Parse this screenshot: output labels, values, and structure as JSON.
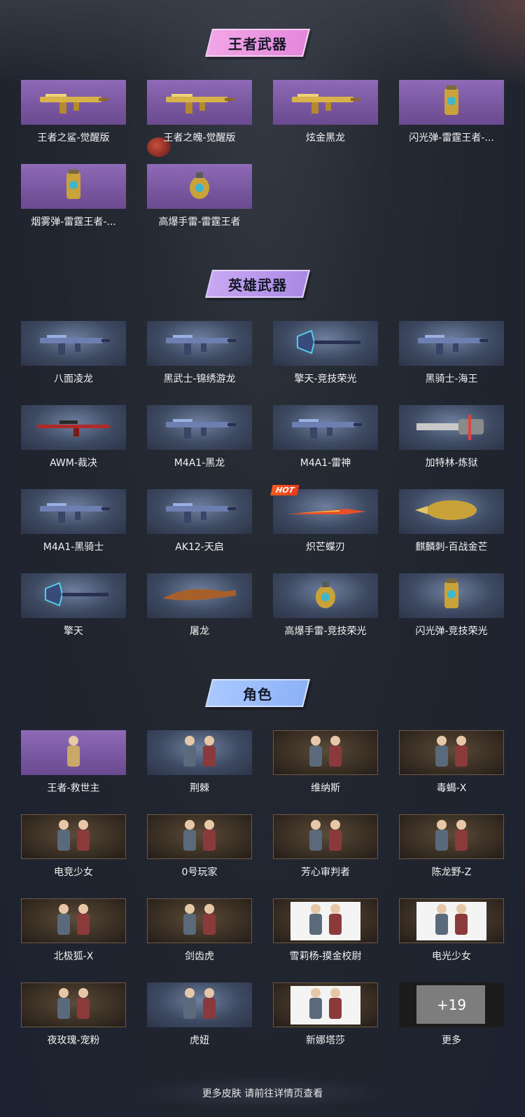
{
  "sections": {
    "king": {
      "title": "王者武器",
      "items": [
        {
          "name": "王者之鲨-觉醒版",
          "icon": "gold-rifle-icon"
        },
        {
          "name": "王者之魄-觉醒版",
          "icon": "gold-rifle-icon"
        },
        {
          "name": "炫金黑龙",
          "icon": "gold-rifle-icon"
        },
        {
          "name": "闪光弹-雷霆王者-...",
          "icon": "flash-grenade-icon"
        },
        {
          "name": "烟雾弹-雷霆王者-...",
          "icon": "smoke-grenade-icon"
        },
        {
          "name": "高爆手雷-雷霆王者",
          "icon": "grenade-icon"
        }
      ]
    },
    "hero": {
      "title": "英雄武器",
      "items": [
        {
          "name": "八面凌龙",
          "icon": "rifle-icon"
        },
        {
          "name": "黑武士-锦绣游龙",
          "icon": "rifle-icon"
        },
        {
          "name": "擎天-竞技荣光",
          "icon": "shovel-icon"
        },
        {
          "name": "黑骑士-海王",
          "icon": "rifle-icon"
        },
        {
          "name": "AWM-裁决",
          "icon": "sniper-icon"
        },
        {
          "name": "M4A1-黑龙",
          "icon": "rifle-icon"
        },
        {
          "name": "M4A1-雷神",
          "icon": "rifle-icon"
        },
        {
          "name": "加特林-炼狱",
          "icon": "gatling-icon"
        },
        {
          "name": "M4A1-黑骑士",
          "icon": "rifle-icon"
        },
        {
          "name": "AK12-天启",
          "icon": "rifle-icon"
        },
        {
          "name": "炽芒蝶刃",
          "icon": "knife-icon",
          "badge": "HOT"
        },
        {
          "name": "麒麟刺-百战金芒",
          "icon": "melee-icon"
        },
        {
          "name": "擎天",
          "icon": "shovel-icon"
        },
        {
          "name": "屠龙",
          "icon": "machete-icon"
        },
        {
          "name": "高爆手雷-竞技荣光",
          "icon": "grenade-icon"
        },
        {
          "name": "闪光弹-竞技荣光",
          "icon": "flash-grenade-icon"
        }
      ]
    },
    "role": {
      "title": "角色",
      "items": [
        {
          "name": "王者-救世主",
          "icon": "character-icon"
        },
        {
          "name": "荆棘",
          "icon": "character-group-icon",
          "banner": "荆棘"
        },
        {
          "name": "维纳斯",
          "icon": "character-group-icon"
        },
        {
          "name": "毒蝎-X",
          "icon": "character-group-icon"
        },
        {
          "name": "电竞少女",
          "icon": "character-group-icon"
        },
        {
          "name": "0号玩家",
          "icon": "character-group-icon"
        },
        {
          "name": "芳心审判者",
          "icon": "character-group-icon"
        },
        {
          "name": "陈龙野-Z",
          "icon": "character-group-icon"
        },
        {
          "name": "北极狐-X",
          "icon": "character-group-icon"
        },
        {
          "name": "剑齿虎",
          "icon": "character-group-icon"
        },
        {
          "name": "雪莉杨-摸金校尉",
          "icon": "character-group-icon"
        },
        {
          "name": "电光少女",
          "icon": "character-group-icon"
        },
        {
          "name": "夜玫瑰-宠粉",
          "icon": "character-group-icon"
        },
        {
          "name": "虎妞",
          "icon": "character-group-icon",
          "banner": "虎妞"
        },
        {
          "name": "新娜塔莎",
          "icon": "character-group-icon"
        },
        {
          "name": "更多",
          "icon": "more-icon",
          "count": "+19"
        }
      ]
    }
  },
  "footer": {
    "text": "更多皮肤 请前往详情页查看"
  },
  "colors": {
    "king_title_bg": "#e487dc",
    "hero_title_bg": "#a98ae4",
    "role_title_bg": "#8db1f7",
    "hot_badge": "#ff5a1f"
  }
}
